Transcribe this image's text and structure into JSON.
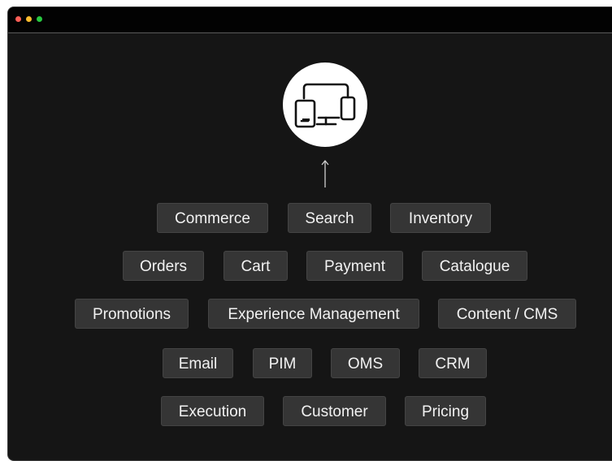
{
  "window": {
    "controls": {
      "close_color": "#ff5f57",
      "minimize_color": "#febc2e",
      "zoom_color": "#28c840"
    }
  },
  "hub": {
    "icon": "devices-icon"
  },
  "connector": {
    "icon": "arrow-up-icon"
  },
  "tags": {
    "row1": [
      "Commerce",
      "Search",
      "Inventory"
    ],
    "row2": [
      "Orders",
      "Cart",
      "Payment",
      "Catalogue"
    ],
    "row3": [
      "Promotions",
      "Experience Management",
      "Content / CMS"
    ],
    "row4": [
      "Email",
      "PIM",
      "OMS",
      "CRM"
    ],
    "row5": [
      "Execution",
      "Customer",
      "Pricing"
    ]
  }
}
